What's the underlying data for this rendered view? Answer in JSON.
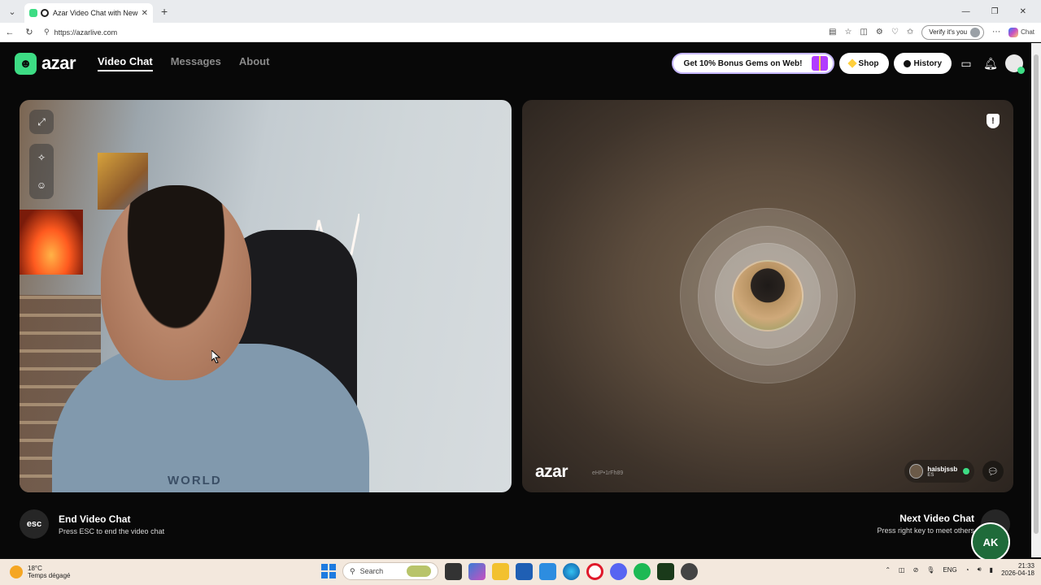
{
  "browser": {
    "tab_title": "Azar Video Chat with New Pe",
    "url": "https://azarlive.com",
    "verify_label": "Verify it's you",
    "copilot_label": "Chat"
  },
  "nav": {
    "brand": "azar",
    "items": [
      {
        "label": "Video Chat",
        "active": true
      },
      {
        "label": "Messages",
        "active": false
      },
      {
        "label": "About",
        "active": false
      }
    ],
    "promo": "Get 10% Bonus Gems on Web!",
    "shop": "Shop",
    "history": "History"
  },
  "local_video": {
    "shirt_text": "WORLD"
  },
  "remote_video": {
    "watermark": "azar",
    "watermark_id": "eHP•1rFh89",
    "partner_name": "haisbjssb",
    "partner_country": "ES"
  },
  "controls": {
    "esc_key": "esc",
    "end_title": "End Video Chat",
    "end_sub": "Press ESC to end the video chat",
    "next_title": "Next Video Chat",
    "next_sub": "Press right key to meet others",
    "channel_logo": "AK"
  },
  "taskbar": {
    "temperature": "18°C",
    "weather": "Temps dégagé",
    "search": "Search",
    "language": "ENG",
    "time": "21:33",
    "date": "2026-04-18"
  },
  "colors": {
    "brand_green": "#3ddc84",
    "background": "#080808"
  }
}
